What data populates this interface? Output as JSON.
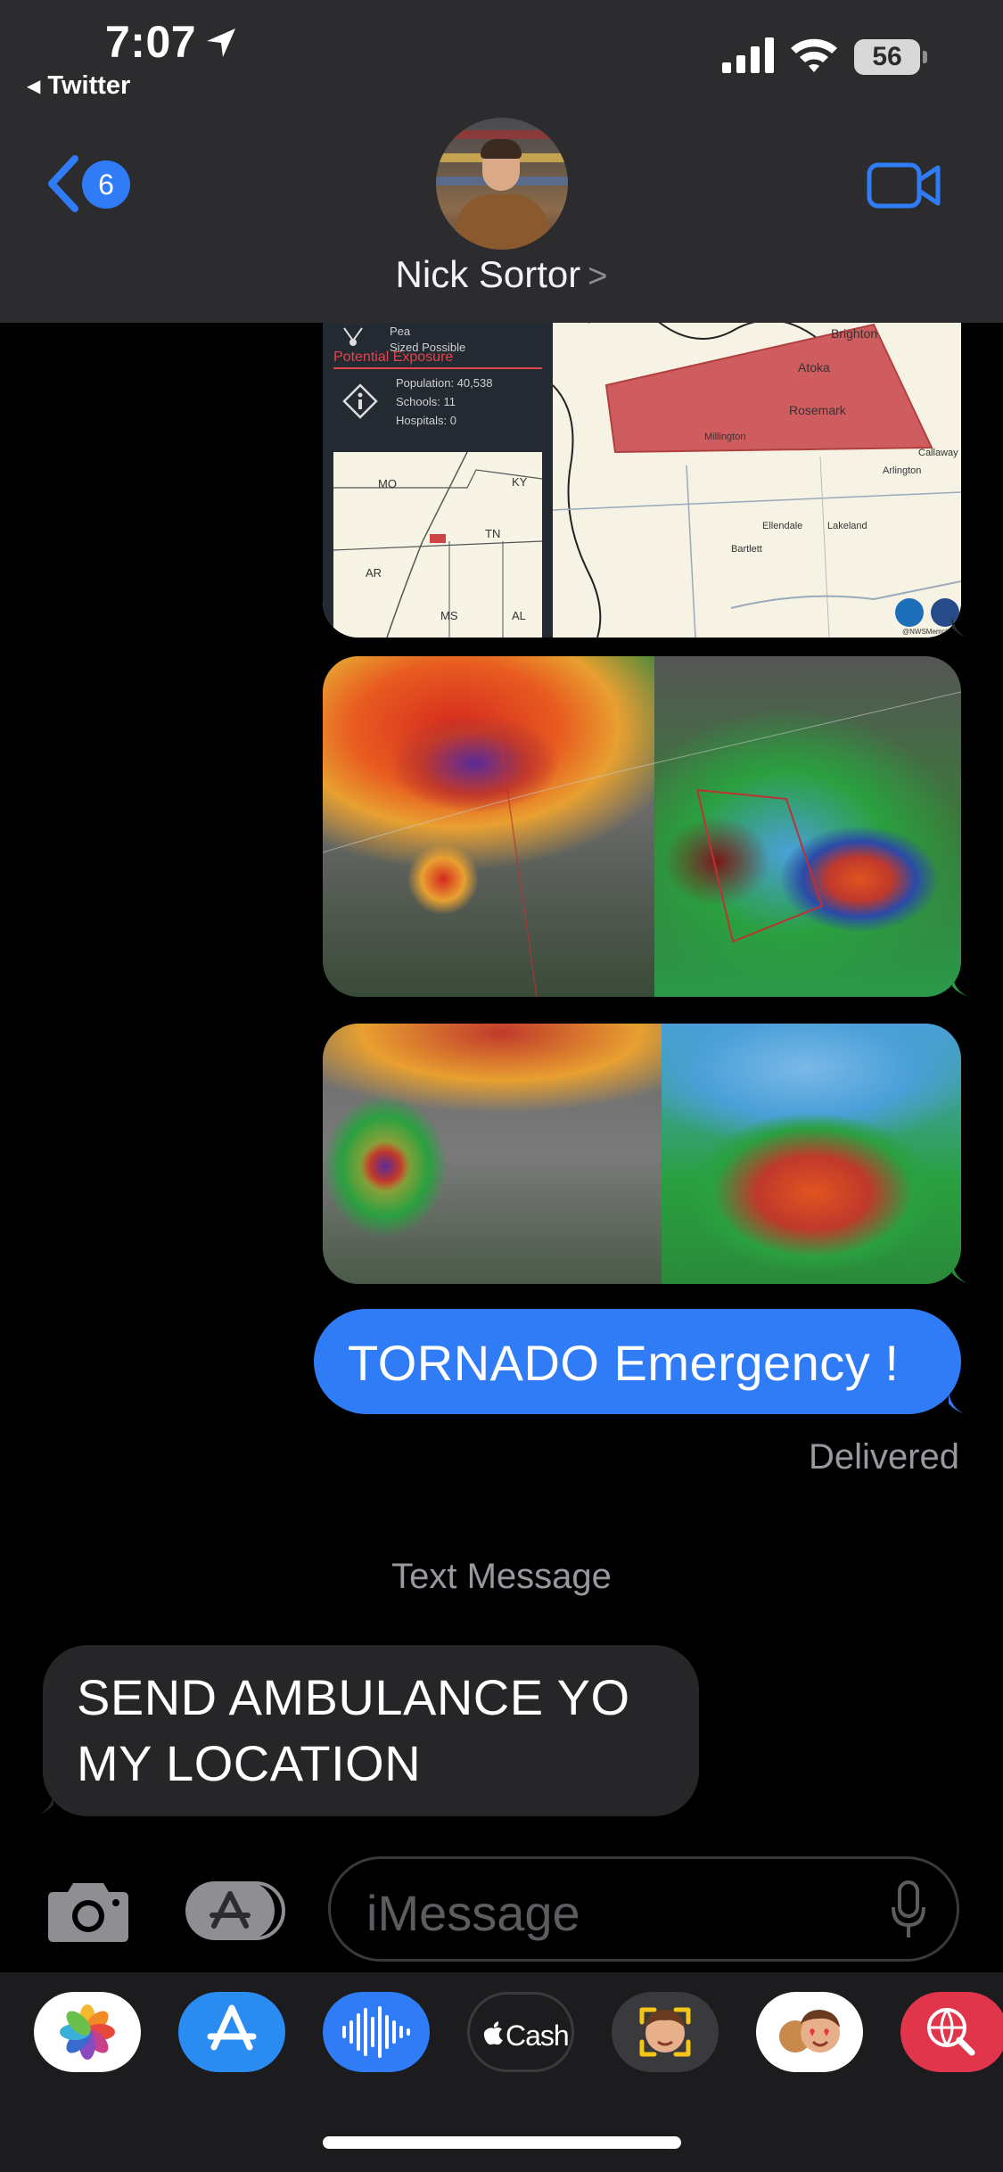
{
  "status_bar": {
    "time": "7:07",
    "back_app_label": "Twitter",
    "battery_level": "56"
  },
  "header": {
    "back_badge_count": "6",
    "contact_name": "Nick Sortor",
    "chevron": ">"
  },
  "messages": {
    "nws_card": {
      "hail_line1": "Pea",
      "hail_line2": "Sized Possible",
      "exposure_title": "Potential Exposure",
      "population": "Population: 40,538",
      "schools": "Schools: 11",
      "hospitals": "Hospitals: 0",
      "inset_states": [
        "MO",
        "KY",
        "AR",
        "TN",
        "MS",
        "AL"
      ],
      "map_places": [
        "Brighton",
        "Atoka",
        "Rosemark",
        "Millington",
        "Arlington",
        "Ellendale",
        "Lakeland",
        "Bartlett",
        "Callaway"
      ],
      "credit": "@NWSMemphis"
    },
    "outgoing_text": "TORNADO Emergency !",
    "delivered_label": "Delivered",
    "service_label": "Text Message",
    "incoming_line1": "SEND AMBULANCE YO",
    "incoming_line2": "MY LOCATION"
  },
  "input_bar": {
    "placeholder": "iMessage"
  },
  "app_drawer": {
    "apps": [
      "photos-app",
      "app-store-app",
      "audio-message-app",
      "apple-cash-app",
      "memoji-app",
      "memoji-stickers-app",
      "image-search-app"
    ],
    "cash_label": "Cash"
  },
  "colors": {
    "header_bg": "#2c2c2e",
    "imessage_blue": "#2f7cf6",
    "incoming_bubble": "#262628",
    "secondary_text": "#98989f"
  }
}
